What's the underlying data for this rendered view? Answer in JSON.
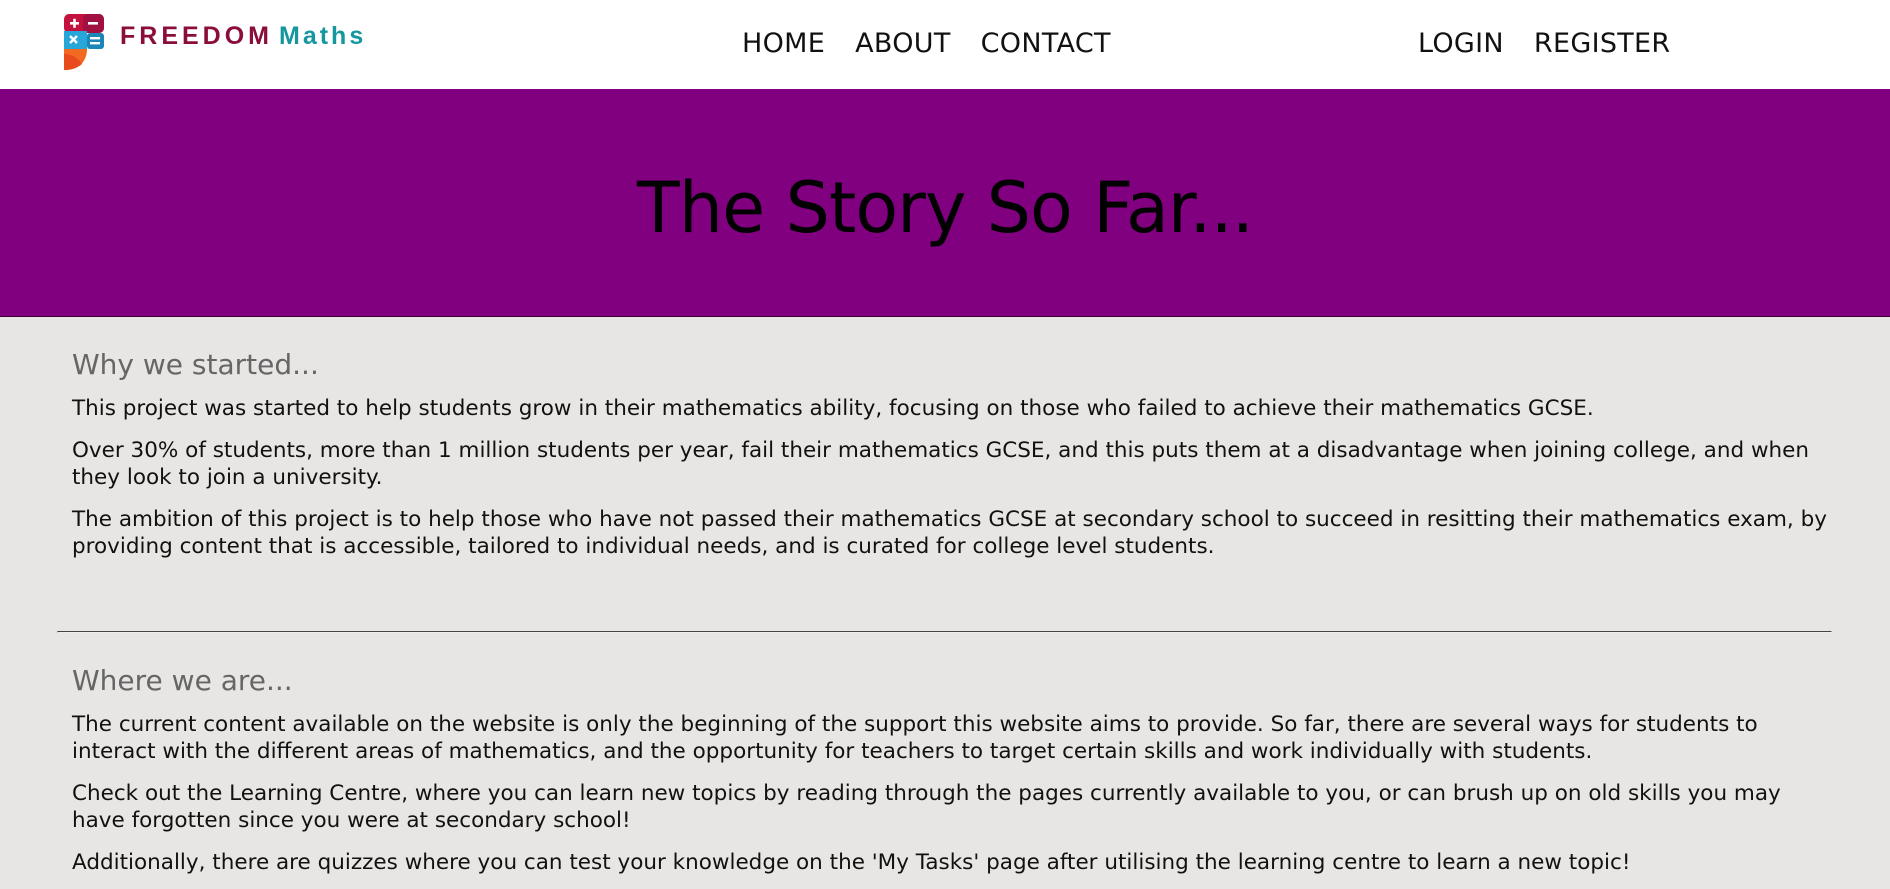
{
  "brand": {
    "word1": "FREEDOM",
    "word2": "Maths",
    "colors": {
      "maroon": "#8b0d3c",
      "teal": "#16979f",
      "orange": "#f26a21",
      "blue": "#29a8dc"
    }
  },
  "nav": {
    "center": [
      "HOME",
      "ABOUT",
      "CONTACT"
    ],
    "right": [
      "LOGIN",
      "REGISTER"
    ]
  },
  "hero": {
    "title": "The Story So Far...",
    "background": "#800080"
  },
  "sections": [
    {
      "heading": "Why we started...",
      "paragraphs": [
        "This project was started to help students grow in their mathematics ability, focusing on those who failed to achieve their mathematics GCSE.",
        "Over 30% of students, more than 1 million students per year, fail their mathematics GCSE, and this puts them at a disadvantage when joining college, and when they look to join a university.",
        "The ambition of this project is to help those who have not passed their mathematics GCSE at secondary school to succeed in resitting their mathematics exam, by providing content that is accessible, tailored to individual needs, and is curated for college level students."
      ]
    },
    {
      "heading": "Where we are...",
      "paragraphs": [
        "The current content available on the website is only the beginning of the support this website aims to provide. So far, there are several ways for students to interact with the different areas of mathematics, and the opportunity for teachers to target certain skills and work individually with students.",
        "Check out the Learning Centre, where you can learn new topics by reading through the pages currently available to you, or can brush up on old skills you may have forgotten since you were at secondary school!",
        "Additionally, there are quizzes where you can test your knowledge on the 'My Tasks' page after utilising the learning centre to learn a new topic!"
      ]
    }
  ]
}
